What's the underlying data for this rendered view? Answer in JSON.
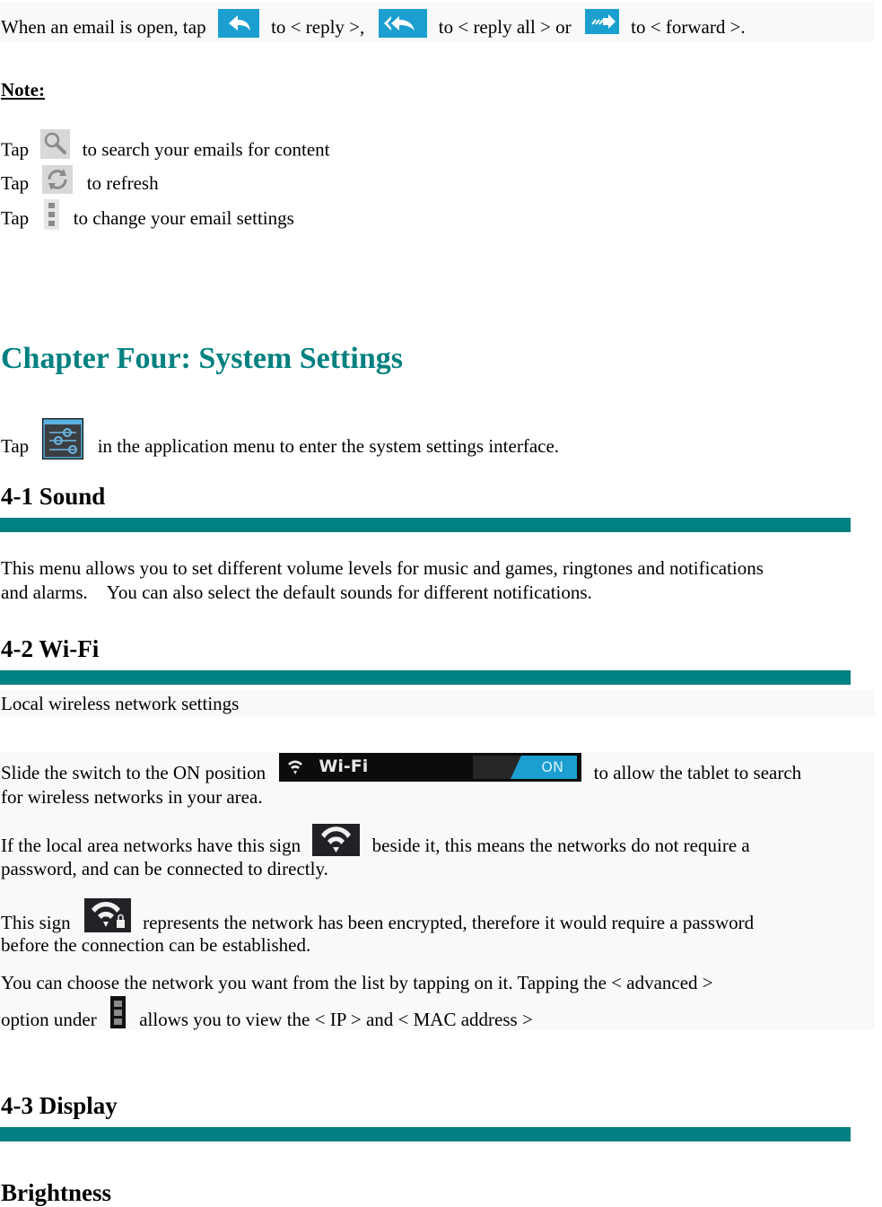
{
  "intro": {
    "p1": "When an email is open, tap",
    "p2": "to < reply >,",
    "p3": "to < reply all > or",
    "p4": "to < forward >.",
    "icons": [
      "reply-icon",
      "reply-all-icon",
      "forward-icon"
    ]
  },
  "note": {
    "title": "Note:",
    "items": [
      {
        "prefix": "Tap",
        "text": "to search your emails for content",
        "icon": "search-icon"
      },
      {
        "prefix": "Tap",
        "text": "to refresh",
        "icon": "refresh-icon"
      },
      {
        "prefix": "Tap",
        "text": "to change your email settings",
        "icon": "overflow-menu-icon"
      }
    ]
  },
  "chapter": {
    "title": "Chapter Four: System Settings",
    "intro_prefix": "Tap",
    "intro_text": "in the application menu to enter the system settings interface.",
    "icon": "settings-sliders-icon"
  },
  "sections": [
    {
      "title": "4-1 Sound",
      "lines": [
        "This menu allows you to set different volume levels for music and games, ringtones and notifications",
        "and alarms.    You can also select the default sounds for different notifications."
      ]
    },
    {
      "title": "4-2 Wi-Fi",
      "subtitle": "Local wireless network settings",
      "p1a": "Slide the switch to the ON position",
      "p1b": "to allow the tablet to search",
      "p1c": "for wireless networks in your area.",
      "switch_label": "Wi-Fi",
      "switch_state": "ON",
      "p2a": "If the local area networks have this sign",
      "p2b": "beside it, this means the networks do not require a",
      "p2c": "password, and can be connected to directly.",
      "p3a": "This sign",
      "p3b": "represents the network has been encrypted, therefore it would require a password",
      "p3c": "before the connection can be established.",
      "p4a": "You can choose the network you want from the list by tapping on it. Tapping the < advanced >",
      "p4b": "option under",
      "p4c": "allows you to view the < IP > and < MAC address >"
    },
    {
      "title": "4-3 Display",
      "subheading": "Brightness"
    }
  ],
  "colors": {
    "accent": "#008080",
    "icon_blue": "#1a9fd0",
    "box_bg": "#f9f9f9"
  }
}
